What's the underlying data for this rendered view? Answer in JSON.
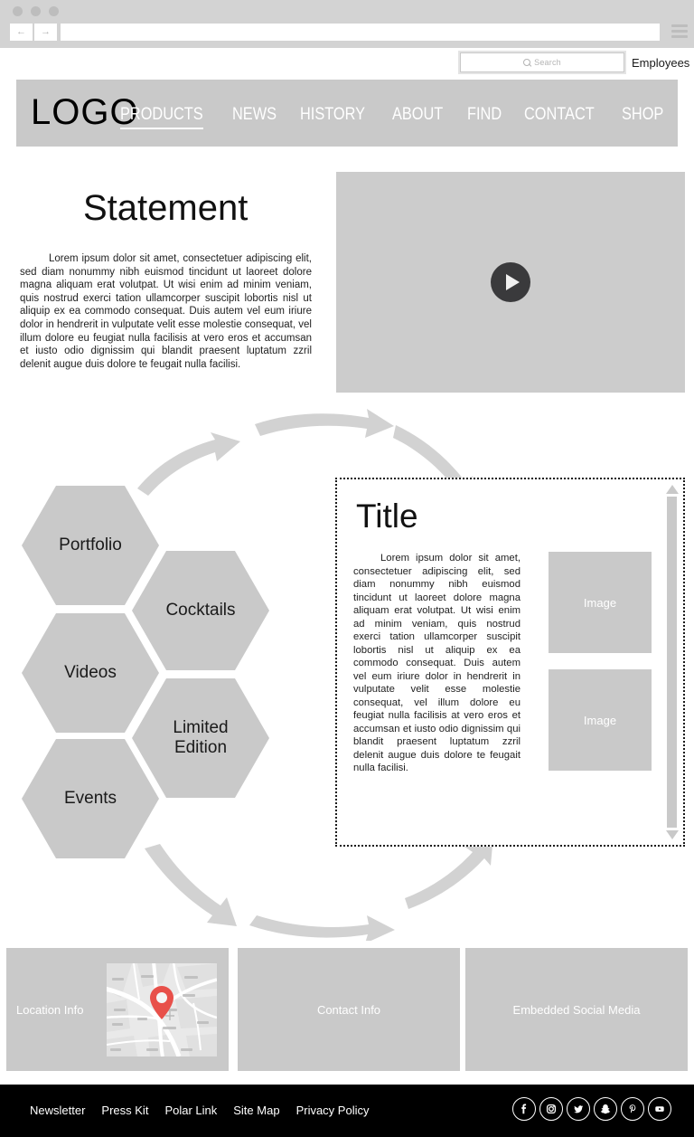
{
  "browser": {
    "dots": [
      "window-dot",
      "window-dot",
      "window-dot"
    ],
    "back_label": "←",
    "forward_label": "→",
    "url_value": "",
    "url_placeholder": "",
    "menu_icon": "hamburger-menu-icon"
  },
  "utility": {
    "search_placeholder": "Search",
    "search_value": "",
    "search_icon": "search-icon",
    "employees_label": "Employees"
  },
  "header": {
    "logo": "LOGO",
    "bg_color": "#c9c9c9",
    "nav": [
      {
        "label": "PRODUCTS",
        "active": true
      },
      {
        "label": "NEWS",
        "active": false
      },
      {
        "label": "HISTORY",
        "active": false
      },
      {
        "label": "ABOUT",
        "active": false
      },
      {
        "label": "FIND",
        "active": false
      },
      {
        "label": "CONTACT",
        "active": false
      },
      {
        "label": "SHOP",
        "active": false
      }
    ]
  },
  "statement": {
    "title": "Statement",
    "body": "Lorem ipsum dolor sit amet, consectetuer adipiscing elit, sed diam nonummy nibh euismod tincidunt ut laoreet dolore magna aliquam erat volutpat. Ut wisi enim ad minim veniam, quis nostrud exerci tation ullamcorper suscipit lobortis nisl ut aliquip ex ea commodo consequat. Duis autem vel eum iriure dolor in hendrerit in vulputate velit esse molestie consequat, vel illum dolore eu feugiat nulla facilisis at vero eros et accumsan et iusto odio dignissim qui blandit praesent luptatum zzril delenit augue duis dolore te feugait nulla facilisi."
  },
  "video": {
    "play_icon": "play-button-icon",
    "bg_color": "#cccccc"
  },
  "hexagons": [
    {
      "label": "Portfolio"
    },
    {
      "label": "Cocktails"
    },
    {
      "label": "Videos"
    },
    {
      "label": "Limited\nEdition"
    },
    {
      "label": "Events"
    }
  ],
  "content_panel": {
    "title": "Title",
    "body": "Lorem ipsum dolor sit amet, consectetuer adipiscing elit, sed diam nonummy nibh euismod tincidunt ut laoreet dolore magna aliquam erat volutpat. Ut wisi enim ad minim veniam, quis nostrud exerci tation ullamcorper suscipit lobortis nisl ut aliquip ex ea commodo consequat. Duis autem vel eum iriure dolor in hendrerit in vulputate velit esse molestie consequat, vel illum dolore eu feugiat nulla facilisis at vero eros et accumsan et iusto odio dignissim qui blandit praesent luptatum zzril delenit augue duis dolore te feugait nulla facilisi.",
    "image_one_label": "Image",
    "image_two_label": "Image",
    "scrollbar_up_icon": "scroll-up-arrow-icon",
    "scrollbar_down_icon": "scroll-down-arrow-icon"
  },
  "info_boxes": [
    {
      "label": "Location Info",
      "has_map": true,
      "pin_color": "#e8504a"
    },
    {
      "label": "Contact Info",
      "has_map": false
    },
    {
      "label": "Embedded Social Media",
      "has_map": false
    }
  ],
  "footer": {
    "bg_color": "#000000",
    "links": [
      {
        "label": "Newsletter"
      },
      {
        "label": "Press Kit"
      },
      {
        "label": "Polar Link"
      },
      {
        "label": "Site Map"
      },
      {
        "label": "Privacy Policy"
      }
    ],
    "social": [
      {
        "name": "facebook-icon"
      },
      {
        "name": "instagram-icon"
      },
      {
        "name": "twitter-icon"
      },
      {
        "name": "snapchat-icon"
      },
      {
        "name": "pinterest-icon"
      },
      {
        "name": "youtube-icon"
      }
    ]
  }
}
